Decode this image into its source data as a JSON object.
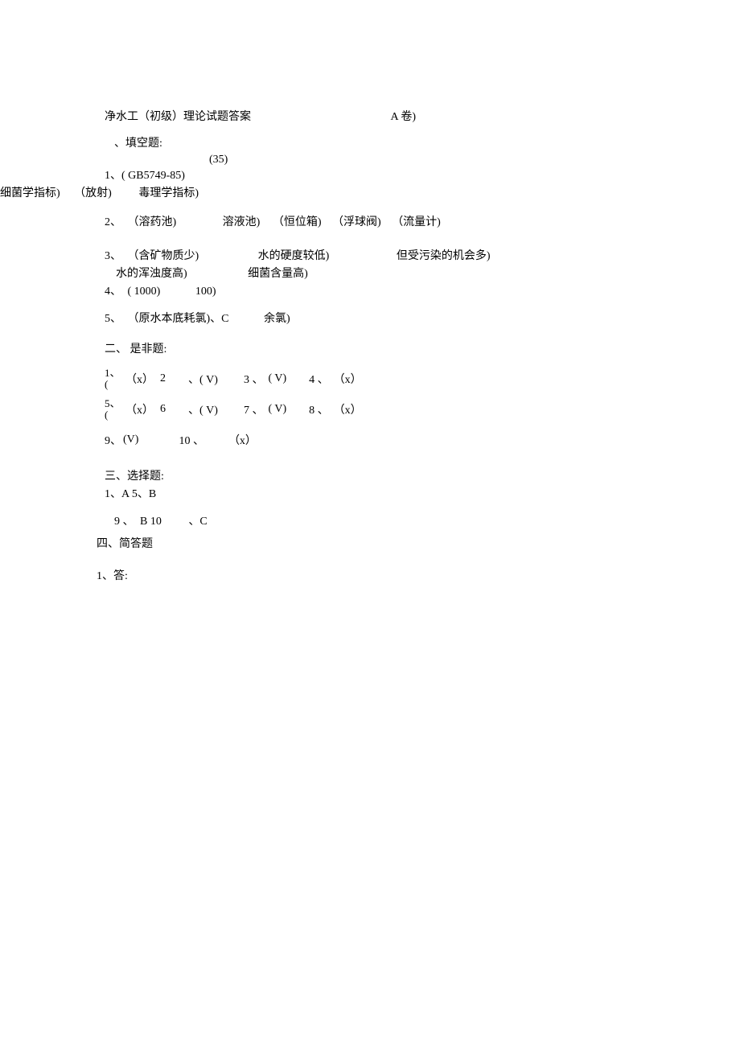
{
  "header": {
    "title_left": "净水工（初级）理论试题答案",
    "title_right": "A 卷)"
  },
  "section1": {
    "heading": "、填空题:",
    "score": "(35)",
    "q1": "1、( GB5749-85)",
    "q1_sub_a": "细菌学指标)",
    "q1_sub_b": "（放射)",
    "q1_sub_c": "毒理学指标)",
    "q2_num": "2、",
    "q2_a": "（溶药池)",
    "q2_b": "溶液池)",
    "q2_c": "（恒位箱)",
    "q2_d": "（浮球阀)",
    "q2_e": "（流量计)",
    "q3_num": "3、",
    "q3_a": "（含矿物质少)",
    "q3_b": "水的硬度较低)",
    "q3_c": "但受污染的机会多)",
    "q3b_a": "水的浑浊度高)",
    "q3b_b": "细菌含量高)",
    "q4_num": "4、",
    "q4_a": "( 1000)",
    "q4_b": "100)",
    "q5_num": "5、",
    "q5_a": "（原水本底耗氯)、C",
    "q5_b": "余氯)"
  },
  "section2": {
    "heading": "二、 是非题:",
    "row1": {
      "num1": "1、(",
      "a1": "（x）",
      "n2": "2",
      "a2": "、( V)",
      "n3": "3 、",
      "a3": "( V)",
      "n4": "4 、",
      "a4": "（x）"
    },
    "row2": {
      "num1": "5、(",
      "a1": "（x）",
      "n2": "6",
      "a2": "、( V)",
      "n3": "7 、",
      "a3": "( V)",
      "n4": "8 、",
      "a4": "（x）"
    },
    "row3": {
      "n1": "9、",
      "a1": "(V)",
      "n2": "10 、",
      "a2": "（x）"
    }
  },
  "section3": {
    "heading": "三、选择题:",
    "line2": "1、A 5、B",
    "line3_a": "9 、",
    "line3_b": "B 10",
    "line3_c": "、C"
  },
  "section4": {
    "heading": "四、简答题"
  },
  "answer1": "1、答:"
}
